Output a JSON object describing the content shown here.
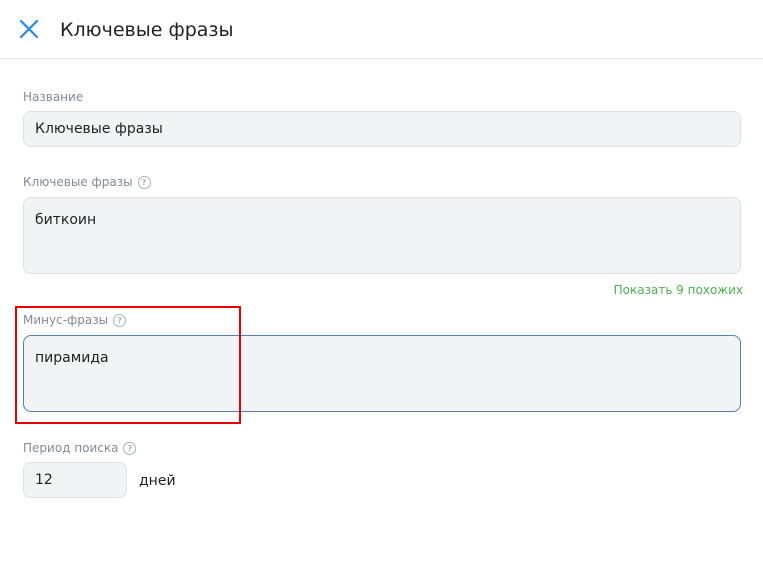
{
  "header": {
    "title": "Ключевые фразы",
    "close_icon": "close-icon"
  },
  "form": {
    "name": {
      "label": "Название",
      "value": "Ключевые фразы"
    },
    "keywords": {
      "label": "Ключевые фразы",
      "value": "биткоин",
      "similar_link": "Показать 9 похожих"
    },
    "minus_phrases": {
      "label": "Минус-фразы",
      "value": "пирамида"
    },
    "search_period": {
      "label": "Период поиска",
      "value": "12",
      "unit": "дней"
    }
  },
  "help_icon_glyph": "?",
  "colors": {
    "accent": "#2688eb",
    "link_green": "#4bb34b",
    "highlight": "#e60000",
    "field_bg": "#f2f3f5"
  }
}
